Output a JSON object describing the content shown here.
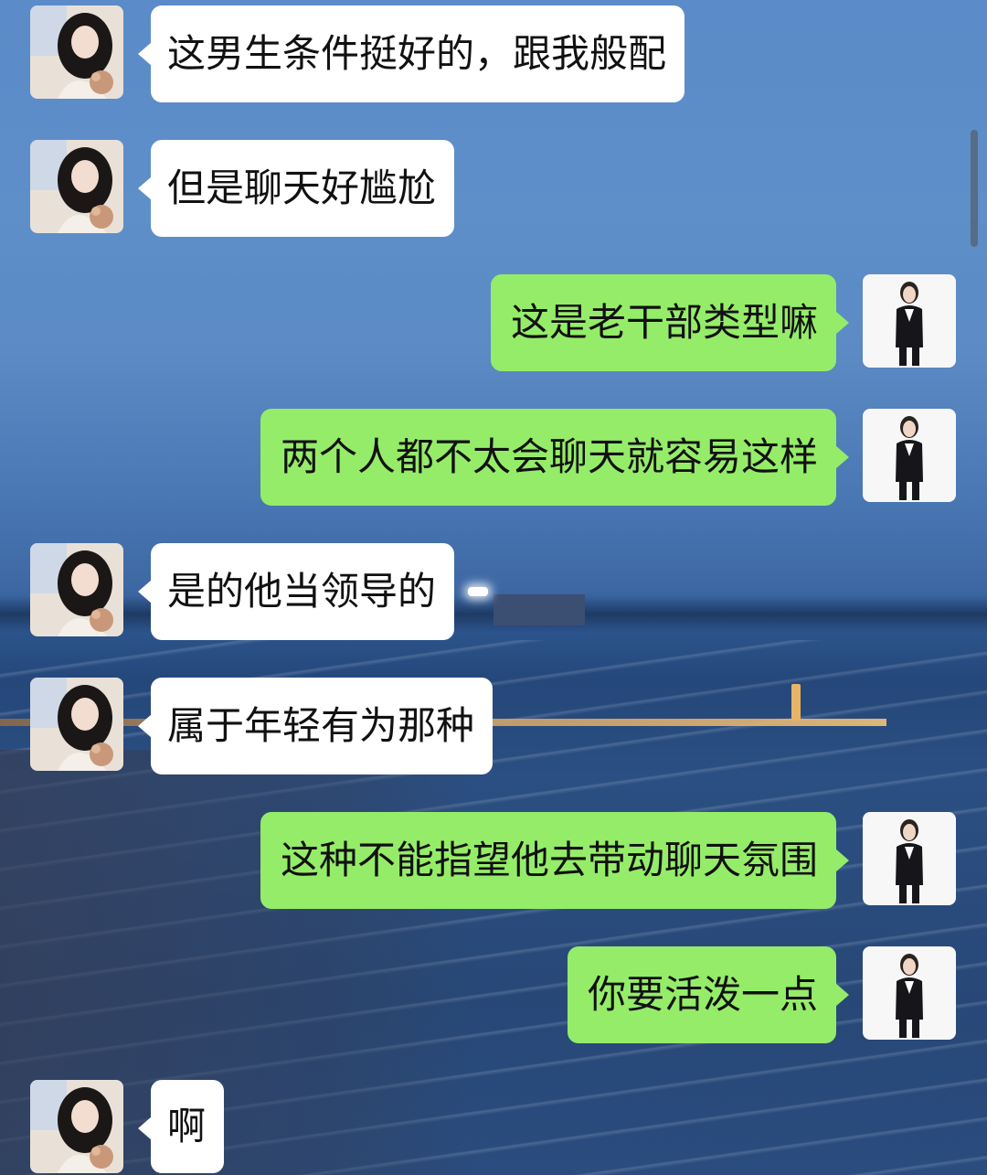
{
  "chat": {
    "messages": [
      {
        "side": "left",
        "text": "这男生条件挺好的，跟我般配",
        "avatar": "sender-avatar"
      },
      {
        "side": "left",
        "text": "但是聊天好尴尬",
        "avatar": "sender-avatar"
      },
      {
        "side": "right",
        "text": "这是老干部类型嘛",
        "avatar": "self-avatar"
      },
      {
        "side": "right",
        "text": "两个人都不太会聊天就容易这样",
        "avatar": "self-avatar"
      },
      {
        "side": "left",
        "text": "是的他当领导的",
        "avatar": "sender-avatar"
      },
      {
        "side": "left",
        "text": "属于年轻有为那种",
        "avatar": "sender-avatar"
      },
      {
        "side": "right",
        "text": "这种不能指望他去带动聊天氛围",
        "avatar": "self-avatar"
      },
      {
        "side": "right",
        "text": "你要活泼一点",
        "avatar": "self-avatar"
      },
      {
        "side": "left",
        "text": "啊",
        "avatar": "sender-avatar"
      }
    ]
  },
  "colors": {
    "incoming_bubble": "#ffffff",
    "outgoing_bubble": "#95ec69",
    "text": "#111111"
  }
}
